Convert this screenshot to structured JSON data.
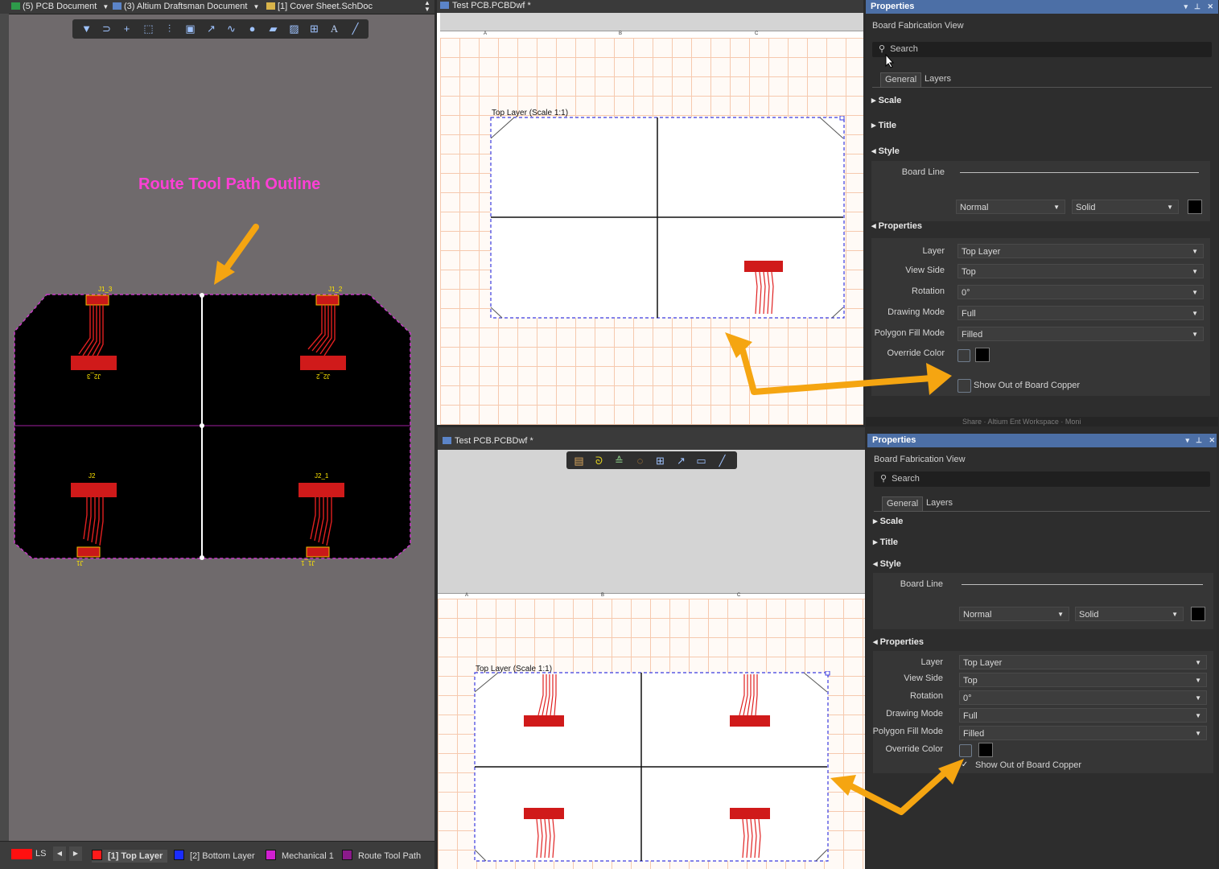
{
  "left_panel": {
    "tabs": [
      {
        "label": "(5) PCB Document",
        "has_menu": true
      },
      {
        "label": "(3) Altium Draftsman Document",
        "has_menu": true
      },
      {
        "label": "[1] Cover Sheet.SchDoc",
        "has_menu": false
      }
    ],
    "annotation": "Route Tool Path Outline",
    "designators": [
      "J1_3",
      "J1_2",
      "J2",
      "J2_1",
      "J2_3",
      "J2_2",
      "J1",
      "J1_1"
    ],
    "layer_tabs": {
      "ls_label": "LS",
      "layers": [
        {
          "label": "[1] Top Layer",
          "color": "#ff1a1a",
          "active": true
        },
        {
          "label": "[2] Bottom Layer",
          "color": "#1a2cff",
          "active": false
        },
        {
          "label": "Mechanical 1",
          "color": "#d21fd2",
          "active": false
        },
        {
          "label": "Route Tool Path",
          "color": "#8a1a8a",
          "active": false
        }
      ]
    }
  },
  "draftsman_top": {
    "tab": "Test PCB.PCBDwf *",
    "zone_letters": [
      "A",
      "B",
      "C"
    ],
    "view_label": "Top Layer (Scale 1:1)",
    "show_out_of_board_copper": false
  },
  "draftsman_bottom": {
    "tab": "Test PCB.PCBDwf *",
    "zone_letters": [
      "A",
      "B",
      "C"
    ],
    "view_label": "Top Layer (Scale 1:1)",
    "show_out_of_board_copper": true
  },
  "properties": {
    "title": "Properties",
    "subtitle": "Board Fabrication View",
    "search_placeholder": "Search",
    "tabs": [
      "General",
      "Layers"
    ],
    "sections": {
      "scale": "Scale",
      "title": "Title",
      "style": "Style",
      "properties": "Properties"
    },
    "board_line_label": "Board Line",
    "line_weight": "Normal",
    "line_style": "Solid",
    "fields": {
      "layer_label": "Layer",
      "layer_value": "Top Layer",
      "view_side_label": "View Side",
      "view_side_value": "Top",
      "rotation_label": "Rotation",
      "rotation_value": "0°",
      "drawing_mode_label": "Drawing Mode",
      "drawing_mode_value": "Full",
      "polygon_fill_label": "Polygon Fill Mode",
      "polygon_fill_value": "Filled",
      "override_color_label": "Override Color"
    },
    "show_out_of_board_copper_label": "Show Out of Board Copper"
  },
  "colors": {
    "route_label": "#ff3fd6",
    "callout_arrow": "#f5a511",
    "board_outline": "#3a3adf",
    "properties_header": "#4c6fa6"
  },
  "background_strip": "Share · Altium Ent Workspace · Moni"
}
